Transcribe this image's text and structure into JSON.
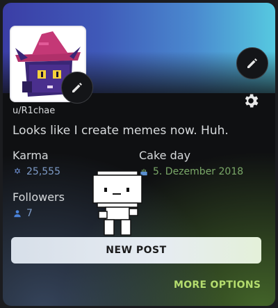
{
  "profile": {
    "username": "u/R1chae",
    "bio": "Looks like I create memes now. Huh."
  },
  "stats": {
    "karma_label": "Karma",
    "karma_value": "25,555",
    "cakeday_label": "Cake day",
    "cakeday_value": "5. Dezember 2018",
    "followers_label": "Followers",
    "followers_value": "7"
  },
  "actions": {
    "new_post": "NEW POST",
    "more_options": "MORE OPTIONS"
  },
  "icons": {
    "edit_avatar": "pencil-icon",
    "edit_banner": "pencil-icon",
    "settings": "gear-icon",
    "karma": "karma-icon",
    "cakeday": "cake-icon",
    "followers": "person-icon"
  },
  "colors": {
    "accent_green": "#b4dc6e",
    "stat_blue": "#7e9bc7",
    "cake_green": "#7aa868"
  }
}
